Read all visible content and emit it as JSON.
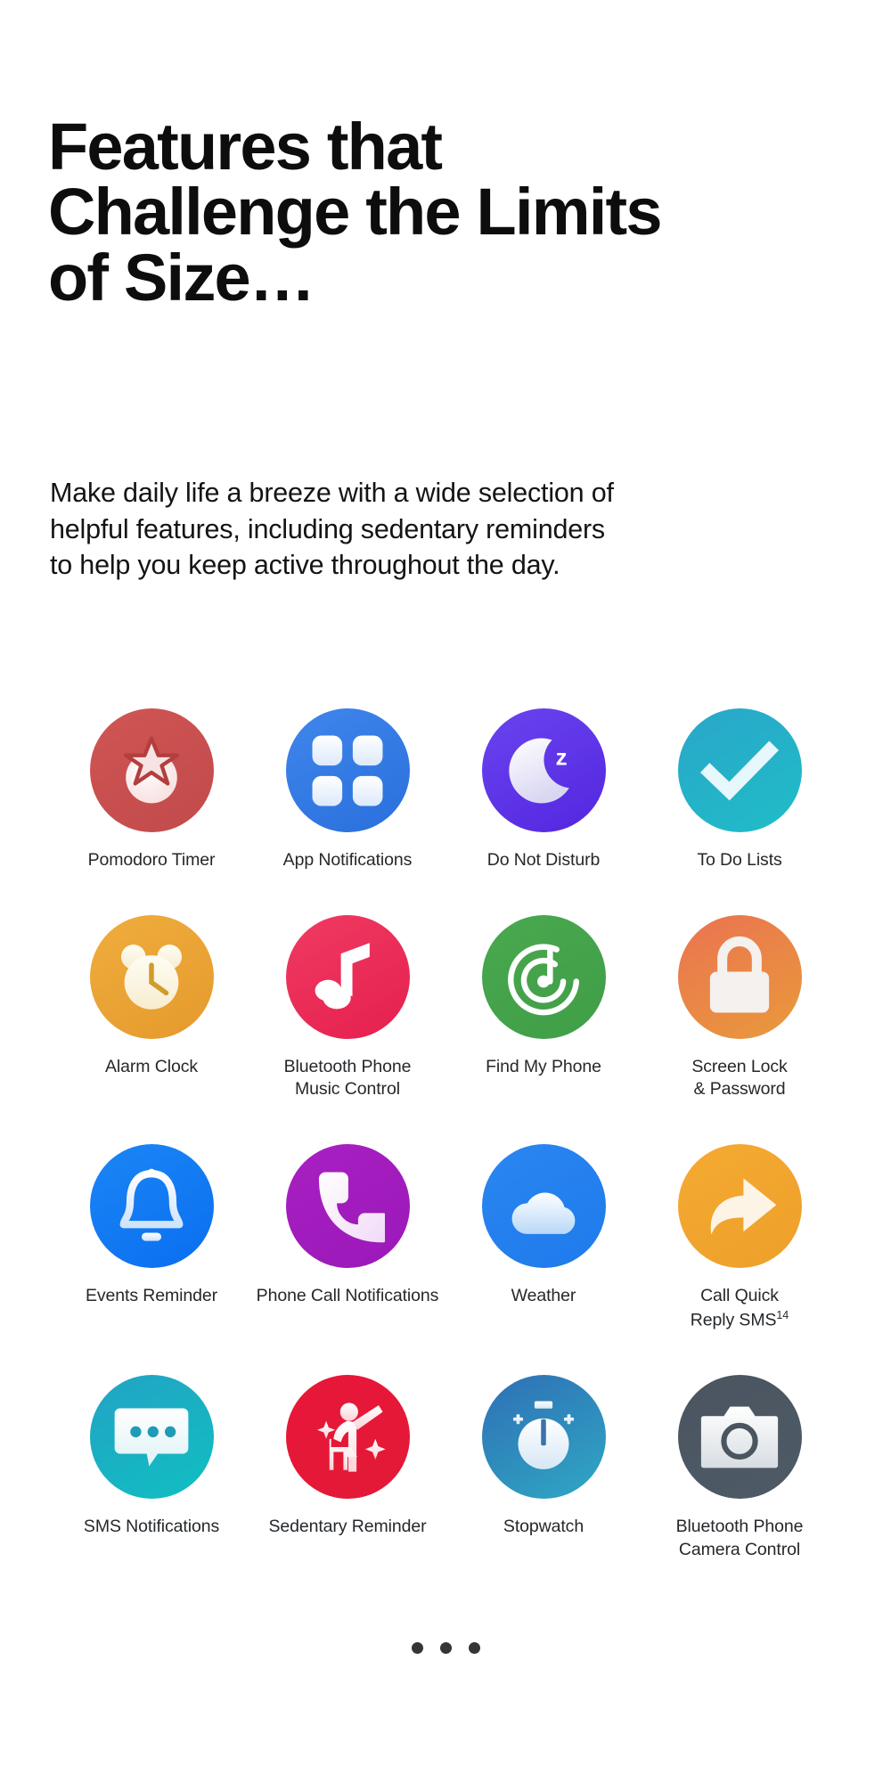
{
  "page": {
    "background": "#ffffff",
    "heading": "Features that\nChallenge the Limits\nof Size…",
    "body_text": "Make daily life a breeze with a wide selection of\nhelpful features, including sedentary reminders\nto help you keep active throughout the day."
  },
  "features": [
    {
      "label": "Pomodoro Timer",
      "icon": "tomato-icon",
      "color_from": "#d05555",
      "color_to": "#c24a4a"
    },
    {
      "label": "App Notifications",
      "icon": "app-grid-icon",
      "color_from": "#3f86ec",
      "color_to": "#2a6fdc"
    },
    {
      "label": "Do Not Disturb",
      "icon": "moon-z-icon",
      "color_from": "#6a44ef",
      "color_to": "#5326e0"
    },
    {
      "label": "To Do Lists",
      "icon": "checkmark-icon",
      "color_from": "#2aa6c9",
      "color_to": "#1fbdc8"
    },
    {
      "label": "Alarm Clock",
      "icon": "alarm-clock-icon",
      "color_from": "#efad3d",
      "color_to": "#e59a2c"
    },
    {
      "label": "Bluetooth Phone\nMusic Control",
      "icon": "music-note-icon",
      "color_from": "#ef3b62",
      "color_to": "#e61f4e"
    },
    {
      "label": "Find My Phone",
      "icon": "radar-icon",
      "color_from": "#4aa martin",
      "color_to": "#3f9e46"
    },
    {
      "label": "Screen Lock\n& Password",
      "icon": "padlock-icon",
      "color_from": "#ea7352",
      "color_to": "#e99a3a"
    },
    {
      "label": "Events Reminder",
      "icon": "bell-icon",
      "color_from": "#1b86f5",
      "color_to": "#0a6ef0"
    },
    {
      "label": "Phone Call Notifications",
      "icon": "phone-handset-icon",
      "color_from": "#a820c2",
      "color_to": "#9b18b8"
    },
    {
      "label": "Weather",
      "icon": "cloud-moon-icon",
      "color_from": "#2a86f0",
      "color_to": "#1f7aec"
    },
    {
      "label": "Call Quick\nReply SMS",
      "icon": "reply-arrow-icon",
      "color_from": "#f5aa32",
      "color_to": "#eda02a",
      "superscript": "14"
    },
    {
      "label": "SMS Notifications",
      "icon": "chat-bubble-icon",
      "color_from": "#22a3c4",
      "color_to": "#10bfc2"
    },
    {
      "label": "Sedentary Reminder",
      "icon": "stretching-person-icon",
      "color_from": "#e8173a",
      "color_to": "#e31836"
    },
    {
      "label": "Stopwatch",
      "icon": "stopwatch-icon",
      "color_from": "#2f6fb5",
      "color_to": "#2fa8c4"
    },
    {
      "label": "Bluetooth Phone\nCamera Control",
      "icon": "camera-icon",
      "color_from": "#4a5560",
      "color_to": "#4e5a66"
    }
  ],
  "pagination": {
    "dots": 3,
    "color": "#333538"
  }
}
